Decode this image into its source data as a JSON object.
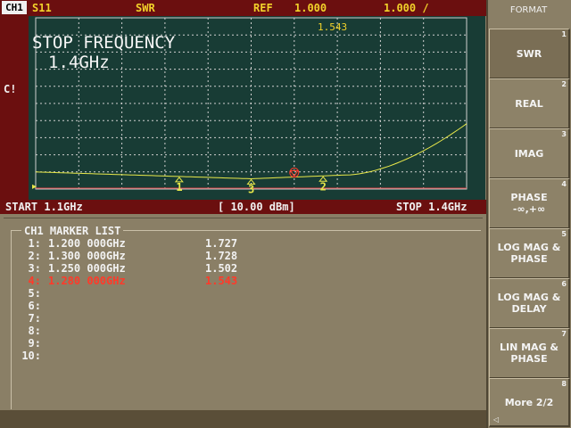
{
  "header": {
    "channel": "CH1",
    "param": "S11",
    "format": "SWR",
    "ref_label": "REF",
    "ref_value": "1.000",
    "scale_value": "1.000 /"
  },
  "left_marker": "C!",
  "overlay": {
    "title": "STOP FREQUENCY",
    "value": "1.4GHz"
  },
  "active_marker_readout": "1.543",
  "scale_bar": {
    "start": "START 1.1GHz",
    "power": "[ 10.00 dBm]",
    "stop": "STOP 1.4GHz"
  },
  "marker_list": {
    "title": "CH1 MARKER LIST",
    "rows": [
      {
        "n": "1:",
        "freq": "1.200 000GHz",
        "val": "1.727"
      },
      {
        "n": "2:",
        "freq": "1.300 000GHz",
        "val": "1.728"
      },
      {
        "n": "3:",
        "freq": "1.250 000GHz",
        "val": "1.502"
      },
      {
        "n": "4:",
        "freq": "1.280 000GHz",
        "val": "1.543"
      },
      {
        "n": "5:",
        "freq": "",
        "val": ""
      },
      {
        "n": "6:",
        "freq": "",
        "val": ""
      },
      {
        "n": "7:",
        "freq": "",
        "val": ""
      },
      {
        "n": "8:",
        "freq": "",
        "val": ""
      },
      {
        "n": "9:",
        "freq": "",
        "val": ""
      },
      {
        "n": "10:",
        "freq": "",
        "val": ""
      }
    ]
  },
  "softkeys": {
    "title": "FORMAT",
    "keys": [
      {
        "label": "SWR",
        "num": "1"
      },
      {
        "label": "REAL",
        "num": "2"
      },
      {
        "label": "IMAG",
        "num": "3"
      },
      {
        "label": "PHASE\n-∞,+∞",
        "num": "4"
      },
      {
        "label": "LOG MAG &\nPHASE",
        "num": "5"
      },
      {
        "label": "LOG MAG &\nDELAY",
        "num": "6"
      },
      {
        "label": "LIN MAG &\nPHASE",
        "num": "7"
      },
      {
        "label": "More 2/2",
        "num": "8"
      }
    ]
  },
  "trace": {
    "color": "#e8e84a",
    "grid_color": "#d0d0d0",
    "plot_bg": "#183c35",
    "active_color": "#ff3a2a",
    "markers": [
      {
        "label": "1",
        "x": 0.333
      },
      {
        "label": "3",
        "x": 0.5
      },
      {
        "label": "2",
        "x": 0.667
      }
    ],
    "active_marker": {
      "label": "4",
      "x": 0.6
    }
  }
}
